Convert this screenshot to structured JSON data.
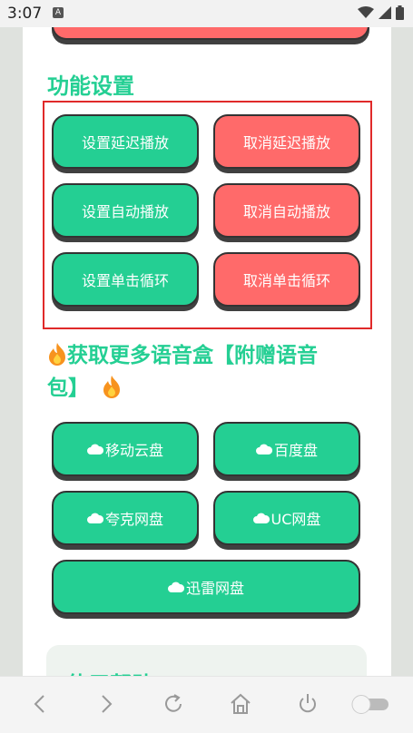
{
  "status_bar": {
    "time": "3:07",
    "notification_badge": "A"
  },
  "top_button": {
    "color": "#ff6a6a"
  },
  "section_settings": {
    "title": "功能设置"
  },
  "settings_buttons": [
    {
      "label": "设置延迟播放",
      "color": "green"
    },
    {
      "label": "取消延迟播放",
      "color": "red"
    },
    {
      "label": "设置自动播放",
      "color": "green"
    },
    {
      "label": "取消自动播放",
      "color": "red"
    },
    {
      "label": "设置单击循环",
      "color": "green"
    },
    {
      "label": "取消单击循环",
      "color": "red"
    }
  ],
  "section_download": {
    "title_line1": "获取更多语音盒【附赠语音",
    "title_line2": "包】"
  },
  "download_buttons": [
    {
      "label": "移动云盘"
    },
    {
      "label": "百度盘"
    },
    {
      "label": "夸克网盘"
    },
    {
      "label": "UC网盘"
    },
    {
      "label": "迅雷网盘"
    }
  ],
  "help_section": {
    "title": "使用帮助"
  },
  "colors": {
    "accent_green": "#24cf93",
    "accent_red": "#ff6a6a",
    "highlight_red": "#e02a2a"
  },
  "nav_icons": [
    "back-icon",
    "forward-icon",
    "refresh-icon",
    "home-icon",
    "power-icon",
    "toggle-switch"
  ]
}
